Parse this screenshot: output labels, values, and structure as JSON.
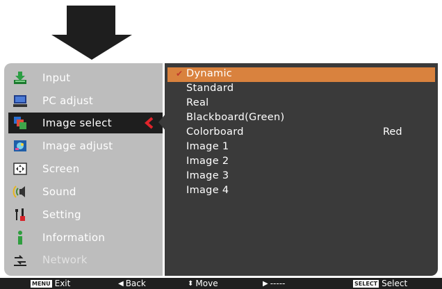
{
  "menu": {
    "items": [
      {
        "label": "Input",
        "icon": "input-icon"
      },
      {
        "label": "PC adjust",
        "icon": "pc-adjust-icon"
      },
      {
        "label": "Image select",
        "icon": "image-select-icon"
      },
      {
        "label": "Image adjust",
        "icon": "image-adjust-icon"
      },
      {
        "label": "Screen",
        "icon": "screen-icon"
      },
      {
        "label": "Sound",
        "icon": "sound-icon"
      },
      {
        "label": "Setting",
        "icon": "setting-icon"
      },
      {
        "label": "Information",
        "icon": "information-icon"
      },
      {
        "label": "Network",
        "icon": "network-icon"
      }
    ],
    "selected": "Image select"
  },
  "submenu": {
    "items": [
      {
        "label": "Dynamic",
        "checked": true
      },
      {
        "label": "Standard"
      },
      {
        "label": "Real"
      },
      {
        "label": "Blackboard(Green)"
      },
      {
        "label": "Colorboard",
        "value": "Red"
      },
      {
        "label": "Image 1"
      },
      {
        "label": "Image 2"
      },
      {
        "label": "Image 3"
      },
      {
        "label": "Image 4"
      }
    ]
  },
  "help": {
    "exit_key": "MENU",
    "exit": "Exit",
    "back": "Back",
    "move": "Move",
    "next": "-----",
    "select_key": "SELECT",
    "select": "Select"
  },
  "colors": {
    "menu_bg": "#bdbdbd",
    "submenu_bg": "#3a3a3a",
    "highlight": "#d9823e",
    "selected_row": "#1e1e1e",
    "selected_chevron": "#e0242b"
  }
}
